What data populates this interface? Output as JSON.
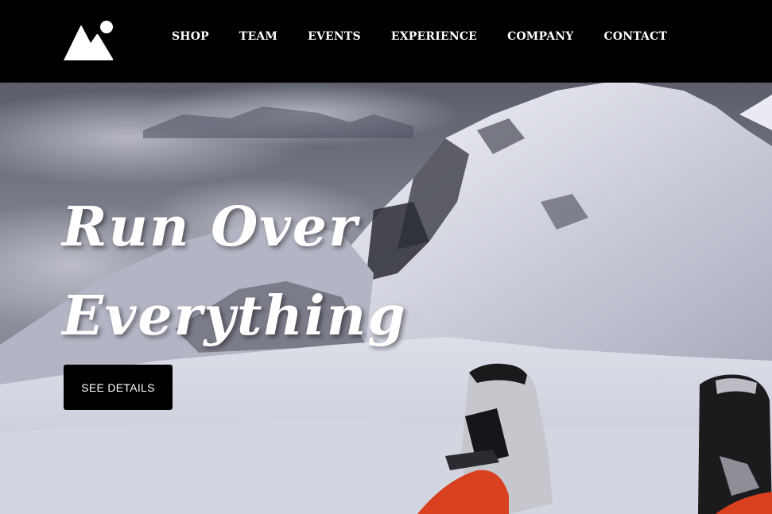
{
  "header": {
    "logo_icon": "mountain-sun-icon",
    "nav": [
      {
        "label": "SHOP"
      },
      {
        "label": "TEAM"
      },
      {
        "label": "EVENTS"
      },
      {
        "label": "EXPERIENCE"
      },
      {
        "label": "COMPANY"
      },
      {
        "label": "CONTACT"
      }
    ]
  },
  "hero": {
    "headline_line1": "Run Over",
    "headline_line2": "Everything",
    "cta_label": "SEE DETAILS",
    "image": "snowy-mountain-ridge-with-ski-boots"
  },
  "colors": {
    "header_bg": "#000000",
    "nav_text": "#ffffff",
    "button_bg": "#000000",
    "button_text": "#ffffff",
    "boot_accent": "#d8401f"
  }
}
